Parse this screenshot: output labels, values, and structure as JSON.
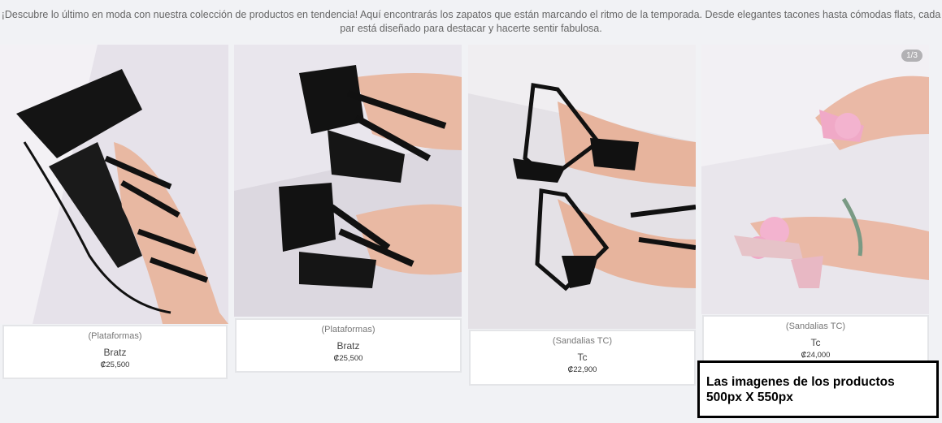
{
  "intro_text": "¡Descubre lo último en moda con nuestra colección de productos en tendencia! Aquí encontrarás los zapatos que están marcando el ritmo de la temporada. Desde elegantes tacones hasta cómodas flats, cada par está diseñado para destacar y hacerte sentir fabulosa.",
  "products": [
    {
      "category": "(Plataformas)",
      "name": "Bratz",
      "price": "₡25,500"
    },
    {
      "category": "(Plataformas)",
      "name": "Bratz",
      "price": "₡25,500"
    },
    {
      "category": "(Sandalias TC)",
      "name": "Tc",
      "price": "₡22,900"
    },
    {
      "category": "(Sandalias TC)",
      "name": "Tc",
      "price": "₡24,000",
      "image_counter": "1/3"
    }
  ],
  "note": {
    "line1": "Las imagenes de los productos",
    "line2": "500px X 550px"
  }
}
